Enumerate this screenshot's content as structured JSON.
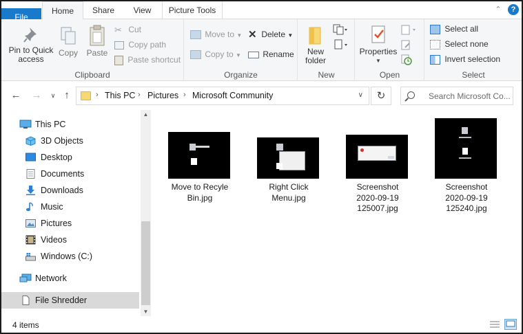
{
  "tabs": {
    "file": "File",
    "home": "Home",
    "share": "Share",
    "view": "View",
    "picture_tools": "Picture Tools"
  },
  "ribbon": {
    "clipboard": {
      "label": "Clipboard",
      "pin": "Pin to Quick access",
      "copy": "Copy",
      "paste": "Paste",
      "cut": "Cut",
      "copy_path": "Copy path",
      "paste_shortcut": "Paste shortcut"
    },
    "organize": {
      "label": "Organize",
      "move_to": "Move to",
      "copy_to": "Copy to",
      "delete": "Delete",
      "rename": "Rename"
    },
    "new": {
      "label": "New",
      "new_folder": "New folder"
    },
    "open": {
      "label": "Open",
      "properties": "Properties"
    },
    "select": {
      "label": "Select",
      "select_all": "Select all",
      "select_none": "Select none",
      "invert_selection": "Invert selection"
    }
  },
  "address": {
    "crumbs": [
      "This PC",
      "Pictures",
      "Microsoft Community"
    ]
  },
  "search": {
    "placeholder": "Search Microsoft Co..."
  },
  "nav_pane": {
    "items": [
      {
        "label": "This PC",
        "icon": "monitor-icon"
      },
      {
        "label": "3D Objects",
        "icon": "cube-icon"
      },
      {
        "label": "Desktop",
        "icon": "desktop-icon"
      },
      {
        "label": "Documents",
        "icon": "document-icon"
      },
      {
        "label": "Downloads",
        "icon": "download-icon"
      },
      {
        "label": "Music",
        "icon": "music-icon"
      },
      {
        "label": "Pictures",
        "icon": "picture-icon"
      },
      {
        "label": "Videos",
        "icon": "film-icon"
      },
      {
        "label": "Windows (C:)",
        "icon": "drive-icon"
      },
      {
        "label": "Network",
        "icon": "network-icon"
      },
      {
        "label": "File Shredder",
        "icon": "file-icon"
      }
    ]
  },
  "files": [
    {
      "name_line1": "Move to Recyle",
      "name_line2": "Bin.jpg",
      "name_line3": ""
    },
    {
      "name_line1": "Right Click",
      "name_line2": "Menu.jpg",
      "name_line3": ""
    },
    {
      "name_line1": "Screenshot",
      "name_line2": "2020-09-19",
      "name_line3": "125007.jpg"
    },
    {
      "name_line1": "Screenshot",
      "name_line2": "2020-09-19",
      "name_line3": "125240.jpg"
    }
  ],
  "status": {
    "count": "4 items"
  },
  "colors": {
    "accent": "#1979ca",
    "ribbon_bg": "#f5f6f7",
    "selection": "#d9d9d9"
  }
}
